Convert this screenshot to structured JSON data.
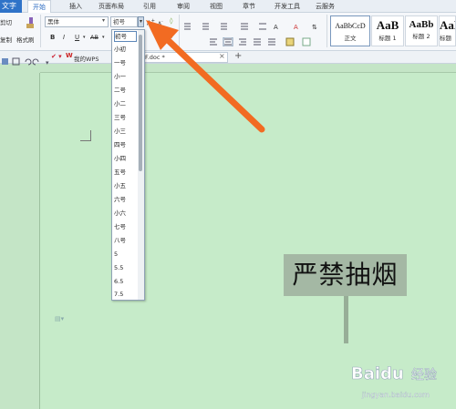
{
  "menu": {
    "app_label": "文字",
    "tabs": [
      "开始",
      "插入",
      "页面布局",
      "引用",
      "审阅",
      "视图",
      "章节",
      "开发工具",
      "云服务"
    ]
  },
  "clipboard": {
    "cut": "剪切",
    "copy": "复制",
    "format_painter": "格式刷"
  },
  "font": {
    "name": "黑体",
    "size": "初号"
  },
  "styles": [
    {
      "preview": "AaBbCcD",
      "label": "正文"
    },
    {
      "preview": "AaB",
      "label": "标题 1"
    },
    {
      "preview": "AaBb",
      "label": "标题 2"
    },
    {
      "preview": "AaB",
      "label": "标题"
    }
  ],
  "quickbar": {
    "my_wps": "我的WPS",
    "doc_tab": "F.doc *"
  },
  "dropdown": {
    "items": [
      "初号",
      "小初",
      "一号",
      "小一",
      "二号",
      "小二",
      "三号",
      "小三",
      "四号",
      "小四",
      "五号",
      "小五",
      "六号",
      "小六",
      "七号",
      "八号",
      "5",
      "5.5",
      "6.5",
      "7.5"
    ],
    "selected": "初号"
  },
  "document": {
    "sign_text": "严禁抽烟"
  },
  "watermark": {
    "brand": "Baidu",
    "cn": "经验",
    "url": "jingyan.baidu.com"
  },
  "colors": {
    "accent": "#2f73c8",
    "arrow": "#f26b22",
    "page": "#c6ebc9",
    "sign": "#a4b8a4"
  }
}
